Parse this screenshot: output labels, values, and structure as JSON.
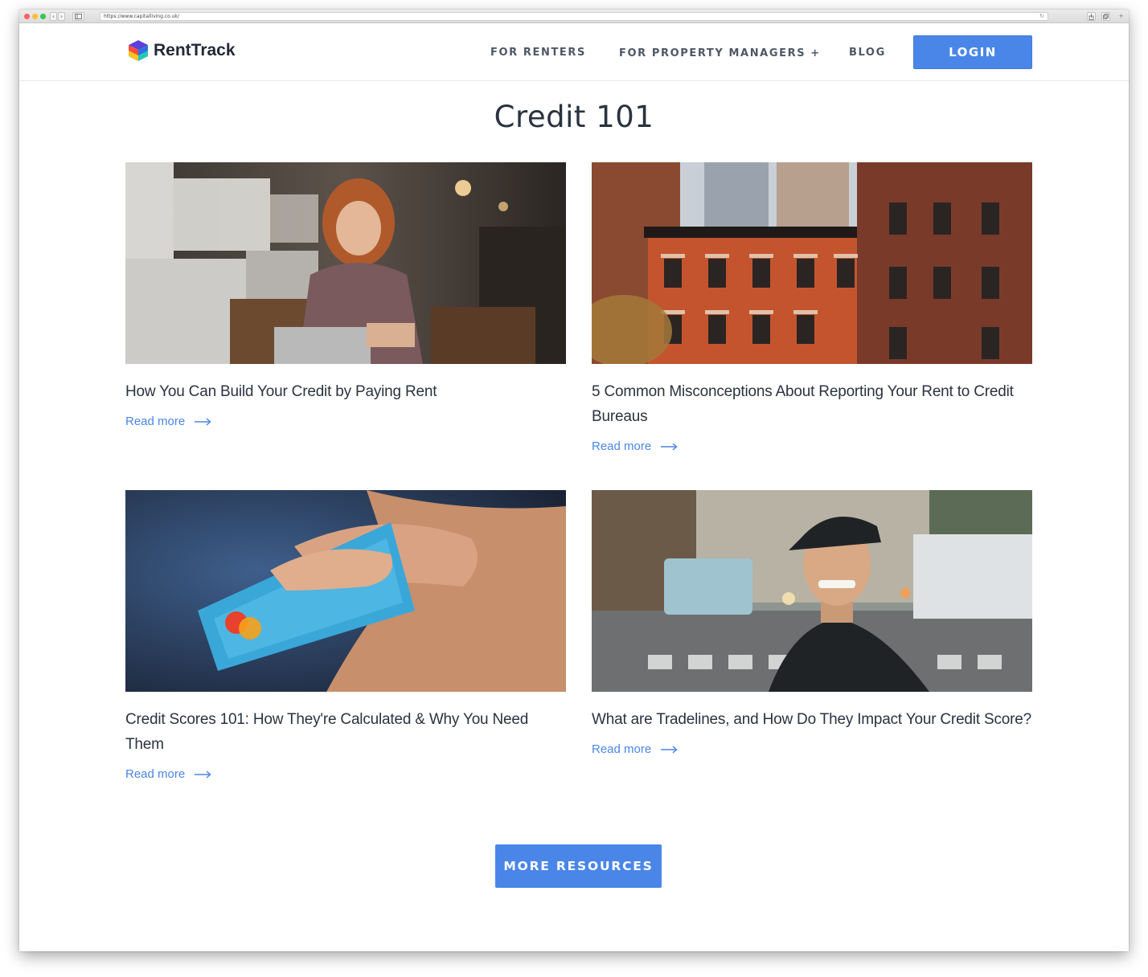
{
  "browser": {
    "url": "https://www.capitalliving.co.uk/",
    "back_glyph": "‹",
    "forward_glyph": "›",
    "reload_glyph": "↻",
    "new_tab_glyph": "+"
  },
  "header": {
    "logo_text": "RentTrack",
    "nav": {
      "renters": "FOR RENTERS",
      "property_managers": "FOR PROPERTY MANAGERS +",
      "blog": "BLOG"
    },
    "login_label": "LOGIN"
  },
  "main": {
    "title": "Credit 101",
    "cards": [
      {
        "title": "How You Can Build Your Credit by Paying Rent",
        "link": "Read more",
        "image": "woman-laptop-cafe-photo"
      },
      {
        "title": "5 Common Misconceptions About Reporting Your Rent to Credit Bureaus",
        "link": "Read more",
        "image": "city-brick-buildings-photo"
      },
      {
        "title": "Credit Scores 101: How They're Calculated & Why You Need Them",
        "link": "Read more",
        "image": "hand-credit-card-photo"
      },
      {
        "title": "What are Tradelines, and How Do They Impact Your Credit Score?",
        "link": "Read more",
        "image": "man-street-cap-photo"
      }
    ],
    "more_button": "MORE RESOURCES"
  },
  "colors": {
    "accent": "#4a86e8",
    "heading": "#2a3340",
    "nav_text": "#4e5766"
  }
}
